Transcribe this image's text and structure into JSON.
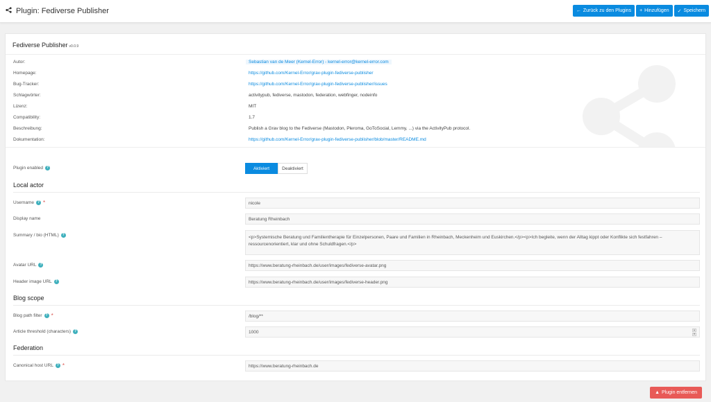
{
  "header": {
    "title": "Plugin: Fediverse Publisher",
    "back_label": "Zurück zu den Plugins",
    "add_label": "Hinzufügen",
    "save_label": "Speichern"
  },
  "plugin": {
    "name": "Fediverse Publisher",
    "version": "v0.0.9"
  },
  "meta": [
    {
      "label": "Autor:",
      "value": "Sebastian van de Meer (Kernel-Error) - kernel-error@kernel-error.com",
      "link": true
    },
    {
      "label": "Homepage:",
      "value": "https://github.com/Kernel-Error/grav-plugin-fediverse-publisher",
      "link": true
    },
    {
      "label": "Bug-Tracker:",
      "value": "https://github.com/Kernel-Error/grav-plugin-fediverse-publisher/issues",
      "link": true
    },
    {
      "label": "Schlagwörter:",
      "value": "activitypub, fediverse, mastodon, federation, webfinger, nodeinfo",
      "link": false
    },
    {
      "label": "Lizenz:",
      "value": "MIT",
      "link": false
    },
    {
      "label": "Compatibility:",
      "value": "1.7",
      "link": false
    },
    {
      "label": "Beschreibung:",
      "value": "Publish a Grav blog to the Fediverse (Mastodon, Pleroma, GoToSocial, Lemmy, ...) via the ActivityPub protocol.",
      "link": false
    },
    {
      "label": "Dokumentation:",
      "value": "https://github.com/Kernel-Error/grav-plugin-fediverse-publisher/blob/master/README.md",
      "link": true
    }
  ],
  "form": {
    "enabled_label": "Plugin enabled",
    "enabled_on": "Aktiviert",
    "enabled_off": "Deaktiviert",
    "section_local_actor": "Local actor",
    "username_label": "Username",
    "username_value": "nicole",
    "display_name_label": "Display name",
    "display_name_value": "Beratung Rheinbach",
    "summary_label": "Summary / bio (HTML)",
    "summary_value": "<p>Systemische Beratung und Familientherapie für Einzelpersonen, Paare und Familien in Rheinbach, Meckenheim und Euskirchen.</p><p>Ich begleite, wenn der Alltag kippt oder Konflikte sich festfahren – ressourcenorientiert, klar und ohne Schuldfragen.</p>",
    "avatar_label": "Avatar URL",
    "avatar_value": "https://www.beratung-rheinbach.de/user/images/fediverse-avatar.png",
    "header_image_label": "Header image URL",
    "header_image_value": "https://www.beratung-rheinbach.de/user/images/fediverse-header.png",
    "section_blog_scope": "Blog scope",
    "blog_path_label": "Blog path filter",
    "blog_path_value": "/blog/**",
    "threshold_label": "Article threshold (characters)",
    "threshold_value": "1000",
    "section_federation": "Federation",
    "canonical_label": "Canonical host URL",
    "canonical_value": "https://www.beratung-rheinbach.de"
  },
  "footer": {
    "remove_label": "Plugin entfernen"
  },
  "colors": {
    "primary": "#0a8be0",
    "danger": "#e85a57",
    "help": "#3fb0bd"
  }
}
